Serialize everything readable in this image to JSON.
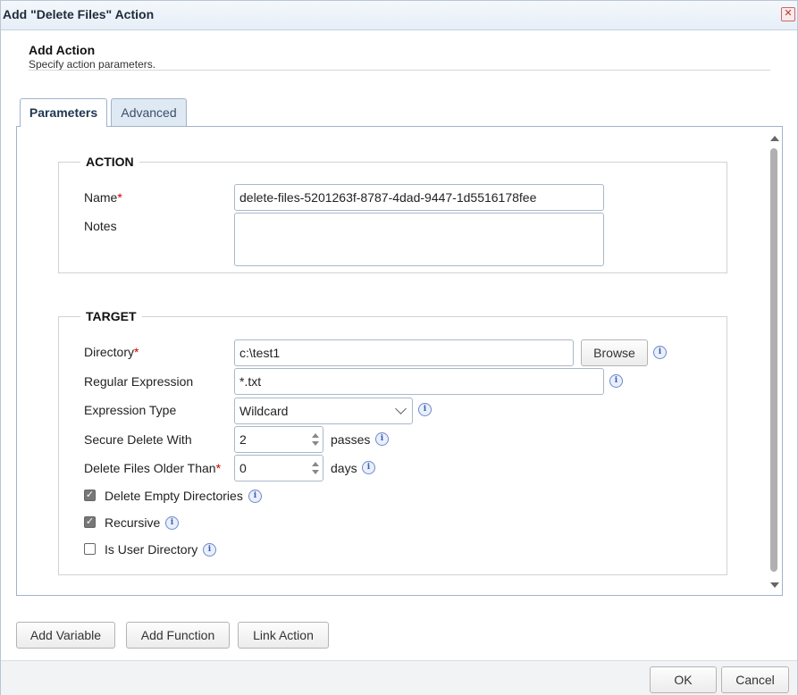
{
  "window": {
    "title": "Add \"Delete Files\" Action",
    "close_glyph": "✕"
  },
  "header": {
    "title": "Add Action",
    "subtitle": "Specify action parameters."
  },
  "tabs": [
    {
      "label": "Parameters"
    },
    {
      "label": "Advanced"
    }
  ],
  "action_section": {
    "legend": "ACTION",
    "name_label": "Name",
    "name_value": "delete-files-5201263f-8787-4dad-9447-1d5516178fee",
    "notes_label": "Notes",
    "notes_value": ""
  },
  "target_section": {
    "legend": "TARGET",
    "directory_label": "Directory",
    "directory_value": "c:\\test1",
    "browse_label": "Browse",
    "regex_label": "Regular Expression",
    "regex_value": "*.txt",
    "expr_type_label": "Expression Type",
    "expr_type_value": "Wildcard",
    "secure_delete_label": "Secure Delete With",
    "secure_delete_value": "2",
    "secure_delete_unit": "passes",
    "older_than_label": "Delete Files Older Than",
    "older_than_value": "0",
    "older_than_unit": "days",
    "delete_empty_label": "Delete Empty Directories",
    "delete_empty_checked": true,
    "recursive_label": "Recursive",
    "recursive_checked": true,
    "user_dir_label": "Is User Directory",
    "user_dir_checked": false
  },
  "required_marker": "*",
  "check_glyph": "✓",
  "info_glyph": "i",
  "bottom_buttons": {
    "add_variable": "Add Variable",
    "add_function": "Add Function",
    "link_action": "Link Action"
  },
  "footer": {
    "ok": "OK",
    "cancel": "Cancel"
  }
}
